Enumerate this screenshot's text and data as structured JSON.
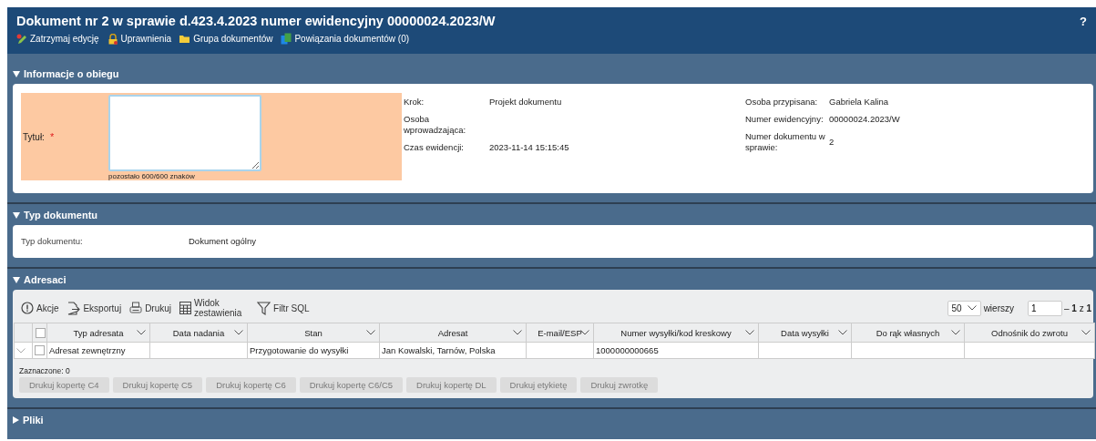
{
  "window": {
    "title": "Dokument nr 2 w sprawie d.423.4.2023 numer ewidencyjny 00000024.2023/W",
    "help": "?"
  },
  "toolbar": [
    {
      "kind": "stop-edit",
      "label": "Zatrzymaj edycję"
    },
    {
      "kind": "lock",
      "label": "Uprawnienia"
    },
    {
      "kind": "folder",
      "label": "Grupa dokumentów"
    },
    {
      "kind": "links",
      "label": "Powiązania dokumentów (0)"
    }
  ],
  "obieg": {
    "title": "Informacje o obiegu",
    "expanded": true,
    "title_field": {
      "label": "Tytuł:",
      "required": "*",
      "counter": "pozostało 600/600 znaków"
    },
    "col1": [
      {
        "label": "Krok:",
        "value": "Projekt dokumentu"
      },
      {
        "label": "Osoba wprowadzająca:"
      },
      {
        "label": "Czas ewidencji:",
        "value": "2023-11-14 15:15:45"
      }
    ],
    "col2": [
      {
        "label": "Osoba przypisana:",
        "value": "Gabriela Kalina"
      },
      {
        "label": "Numer ewidencyjny:",
        "value": "00000024.2023/W"
      },
      {
        "label": "Numer dokumentu w sprawie:",
        "value": "2"
      }
    ]
  },
  "typ": {
    "title": "Typ dokumentu",
    "expanded": true,
    "label": "Typ dokumentu:",
    "value": "Dokument ogólny"
  },
  "adresaci": {
    "title": "Adresaci",
    "expanded": true,
    "actions": [
      {
        "kind": "alert",
        "label": "Akcje"
      },
      {
        "kind": "export",
        "label": "Eksportuj"
      },
      {
        "kind": "print",
        "label": "Drukuj"
      },
      {
        "kind": "grid",
        "label": "Widok zestawienia"
      },
      {
        "kind": "filter",
        "label": "Filtr SQL"
      }
    ],
    "page_size": "50",
    "page_size_label": "wierszy",
    "page": "1",
    "page_info": "– **1** z **1**",
    "select_all": false,
    "columns": [
      "Typ adresata",
      "Data nadania",
      "Stan",
      "Adresat",
      "E-mail/ESP",
      "Numer wysyłki/kod kreskowy",
      "Data wysyłki",
      "Do rąk własnych",
      "Odnośnik do zwrotu"
    ],
    "rows": [
      {
        "checked": false,
        "expanded": false,
        "cells": [
          "Adresat zewnętrzny",
          null,
          "Przygotowanie do wysyłki",
          "Jan Kowalski, Tarnów, Polska",
          null,
          "1000000000665",
          null,
          null,
          null
        ]
      }
    ],
    "selected_count": "Zaznaczone: 0",
    "buttons": [
      {
        "label": "Drukuj kopertę C4",
        "disabled": true
      },
      {
        "label": "Drukuj kopertę C5",
        "disabled": true
      },
      {
        "label": "Drukuj kopertę C6",
        "disabled": true
      },
      {
        "label": "Drukuj kopertę C6/C5",
        "disabled": true
      },
      {
        "label": "Drukuj kopertę DL",
        "disabled": true
      },
      {
        "label": "Drukuj etykietę",
        "disabled": true
      },
      {
        "label": "Drukuj zwrotkę",
        "disabled": true
      }
    ]
  },
  "pliki": {
    "title": "Pliki",
    "expanded": false
  }
}
